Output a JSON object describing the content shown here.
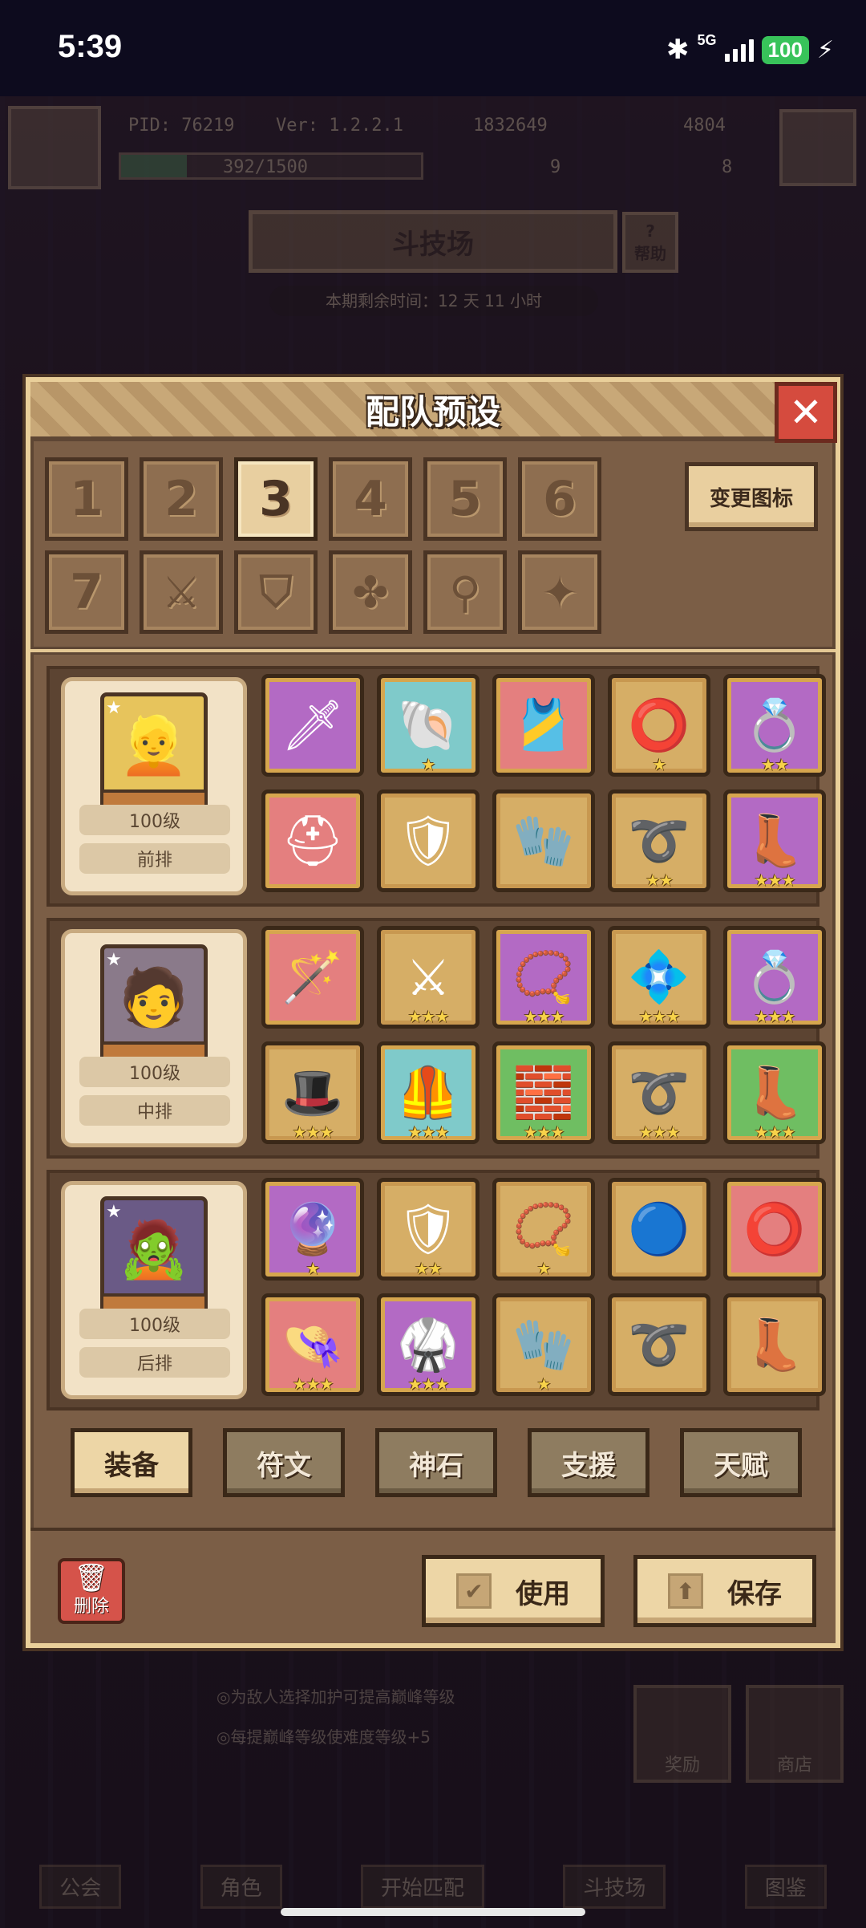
{
  "status_bar": {
    "time": "5:39",
    "network": "5G",
    "battery": "100"
  },
  "background": {
    "pid": "PID: 76219",
    "version": "Ver: 1.2.2.1",
    "gold": "1832649",
    "gems": "4804",
    "exp": "392/1500",
    "res1": "9",
    "res2": "8",
    "screen_title": "斗技场",
    "help": "帮助",
    "timer": "本期剩余时间：12 天 11 小时",
    "tip1": "◎为敌人选择加护可提高巅峰等级",
    "tip2": "◎每提巅峰等级使难度等级+5",
    "side_buttons": [
      "奖励",
      "商店"
    ],
    "nav": [
      "公会",
      "角色",
      "开始匹配",
      "斗技场",
      "图鉴"
    ]
  },
  "dialog": {
    "title": "配队预设",
    "presets": [
      "1",
      "2",
      "3",
      "4",
      "5",
      "6",
      "7"
    ],
    "active_preset": "3",
    "icon_presets": [
      "crossed-swords",
      "shield",
      "crossbow",
      "key",
      "shuriken"
    ],
    "change_icon_label": "变更图标",
    "teams": [
      {
        "level": "100级",
        "position": "前排",
        "portrait": "blonde-hero",
        "equipment": [
          {
            "icon": "sword",
            "rarity": "purple",
            "stars": ""
          },
          {
            "icon": "shell",
            "rarity": "blue",
            "stars": "★"
          },
          {
            "icon": "amulet",
            "rarity": "red",
            "stars": ""
          },
          {
            "icon": "ring",
            "rarity": "gold",
            "stars": "★"
          },
          {
            "icon": "crystal-ring",
            "rarity": "purple",
            "stars": "★★"
          },
          {
            "icon": "helmet",
            "rarity": "red",
            "stars": ""
          },
          {
            "icon": "armor",
            "rarity": "gold",
            "stars": ""
          },
          {
            "icon": "gloves",
            "rarity": "gold",
            "stars": ""
          },
          {
            "icon": "belt",
            "rarity": "gold",
            "stars": "★★"
          },
          {
            "icon": "boots",
            "rarity": "purple",
            "stars": "★★★"
          }
        ]
      },
      {
        "level": "100级",
        "position": "中排",
        "portrait": "dark-hair-hero",
        "equipment": [
          {
            "icon": "staff",
            "rarity": "red",
            "stars": ""
          },
          {
            "icon": "dual-swords",
            "rarity": "gold",
            "stars": "★★★"
          },
          {
            "icon": "necklace",
            "rarity": "purple",
            "stars": "★★★"
          },
          {
            "icon": "gem-ornament",
            "rarity": "gold",
            "stars": "★★★"
          },
          {
            "icon": "crystal-ring",
            "rarity": "purple",
            "stars": "★★★"
          },
          {
            "icon": "hat",
            "rarity": "gold",
            "stars": "★★★"
          },
          {
            "icon": "chest-armor",
            "rarity": "blue",
            "stars": "★★★"
          },
          {
            "icon": "bracer",
            "rarity": "green",
            "stars": "★★★"
          },
          {
            "icon": "belt",
            "rarity": "gold",
            "stars": "★★★"
          },
          {
            "icon": "boots",
            "rarity": "green",
            "stars": "★★★"
          }
        ]
      },
      {
        "level": "100级",
        "position": "后排",
        "portrait": "green-skin-hero",
        "equipment": [
          {
            "icon": "wand",
            "rarity": "purple",
            "stars": "★"
          },
          {
            "icon": "shield",
            "rarity": "gold",
            "stars": "★★"
          },
          {
            "icon": "pendant",
            "rarity": "gold",
            "stars": "★"
          },
          {
            "icon": "orb",
            "rarity": "gold",
            "stars": ""
          },
          {
            "icon": "ring",
            "rarity": "red",
            "stars": ""
          },
          {
            "icon": "hat",
            "rarity": "red",
            "stars": "★★★"
          },
          {
            "icon": "robe",
            "rarity": "purple",
            "stars": "★★★"
          },
          {
            "icon": "gauntlet",
            "rarity": "gold",
            "stars": "★"
          },
          {
            "icon": "belt",
            "rarity": "gold",
            "stars": ""
          },
          {
            "icon": "boots",
            "rarity": "gold",
            "stars": ""
          }
        ]
      }
    ],
    "tabs": [
      "装备",
      "符文",
      "神石",
      "支援",
      "天赋"
    ],
    "active_tab": "装备",
    "delete_label": "删除",
    "use_label": "使用",
    "save_label": "保存"
  }
}
